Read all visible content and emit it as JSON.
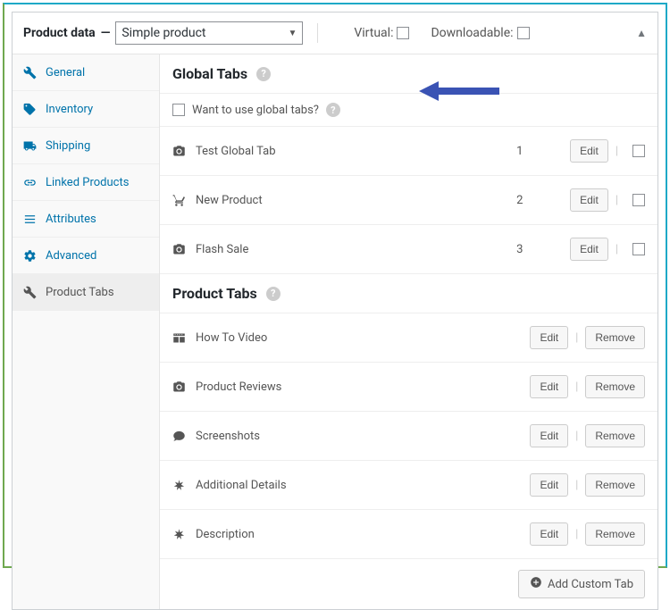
{
  "header": {
    "title": "Product data",
    "dropdown_value": "Simple product",
    "virtual_label": "Virtual:",
    "downloadable_label": "Downloadable:"
  },
  "sidebar": {
    "items": [
      {
        "label": "General"
      },
      {
        "label": "Inventory"
      },
      {
        "label": "Shipping"
      },
      {
        "label": "Linked Products"
      },
      {
        "label": "Attributes"
      },
      {
        "label": "Advanced"
      },
      {
        "label": "Product Tabs"
      }
    ]
  },
  "global_section": {
    "title": "Global Tabs",
    "checkbox_label": "Want to use global tabs?",
    "rows": [
      {
        "label": "Test Global Tab",
        "index": "1",
        "edit": "Edit"
      },
      {
        "label": "New Product",
        "index": "2",
        "edit": "Edit"
      },
      {
        "label": "Flash Sale",
        "index": "3",
        "edit": "Edit"
      }
    ]
  },
  "product_section": {
    "title": "Product Tabs",
    "rows": [
      {
        "label": "How To Video",
        "edit": "Edit",
        "remove": "Remove"
      },
      {
        "label": "Product Reviews",
        "edit": "Edit",
        "remove": "Remove"
      },
      {
        "label": "Screenshots",
        "edit": "Edit",
        "remove": "Remove"
      },
      {
        "label": "Additional Details",
        "edit": "Edit",
        "remove": "Remove"
      },
      {
        "label": "Description",
        "edit": "Edit",
        "remove": "Remove"
      }
    ],
    "add_label": "Add Custom Tab"
  }
}
